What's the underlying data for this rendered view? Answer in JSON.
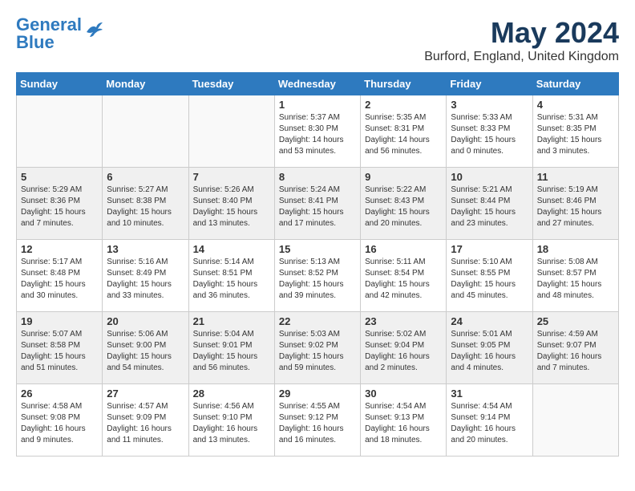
{
  "logo": {
    "line1": "General",
    "line2": "Blue"
  },
  "title": "May 2024",
  "location": "Burford, England, United Kingdom",
  "days_of_week": [
    "Sunday",
    "Monday",
    "Tuesday",
    "Wednesday",
    "Thursday",
    "Friday",
    "Saturday"
  ],
  "weeks": [
    [
      {
        "day": "",
        "text": ""
      },
      {
        "day": "",
        "text": ""
      },
      {
        "day": "",
        "text": ""
      },
      {
        "day": "1",
        "text": "Sunrise: 5:37 AM\nSunset: 8:30 PM\nDaylight: 14 hours and 53 minutes."
      },
      {
        "day": "2",
        "text": "Sunrise: 5:35 AM\nSunset: 8:31 PM\nDaylight: 14 hours and 56 minutes."
      },
      {
        "day": "3",
        "text": "Sunrise: 5:33 AM\nSunset: 8:33 PM\nDaylight: 15 hours and 0 minutes."
      },
      {
        "day": "4",
        "text": "Sunrise: 5:31 AM\nSunset: 8:35 PM\nDaylight: 15 hours and 3 minutes."
      }
    ],
    [
      {
        "day": "5",
        "text": "Sunrise: 5:29 AM\nSunset: 8:36 PM\nDaylight: 15 hours and 7 minutes."
      },
      {
        "day": "6",
        "text": "Sunrise: 5:27 AM\nSunset: 8:38 PM\nDaylight: 15 hours and 10 minutes."
      },
      {
        "day": "7",
        "text": "Sunrise: 5:26 AM\nSunset: 8:40 PM\nDaylight: 15 hours and 13 minutes."
      },
      {
        "day": "8",
        "text": "Sunrise: 5:24 AM\nSunset: 8:41 PM\nDaylight: 15 hours and 17 minutes."
      },
      {
        "day": "9",
        "text": "Sunrise: 5:22 AM\nSunset: 8:43 PM\nDaylight: 15 hours and 20 minutes."
      },
      {
        "day": "10",
        "text": "Sunrise: 5:21 AM\nSunset: 8:44 PM\nDaylight: 15 hours and 23 minutes."
      },
      {
        "day": "11",
        "text": "Sunrise: 5:19 AM\nSunset: 8:46 PM\nDaylight: 15 hours and 27 minutes."
      }
    ],
    [
      {
        "day": "12",
        "text": "Sunrise: 5:17 AM\nSunset: 8:48 PM\nDaylight: 15 hours and 30 minutes."
      },
      {
        "day": "13",
        "text": "Sunrise: 5:16 AM\nSunset: 8:49 PM\nDaylight: 15 hours and 33 minutes."
      },
      {
        "day": "14",
        "text": "Sunrise: 5:14 AM\nSunset: 8:51 PM\nDaylight: 15 hours and 36 minutes."
      },
      {
        "day": "15",
        "text": "Sunrise: 5:13 AM\nSunset: 8:52 PM\nDaylight: 15 hours and 39 minutes."
      },
      {
        "day": "16",
        "text": "Sunrise: 5:11 AM\nSunset: 8:54 PM\nDaylight: 15 hours and 42 minutes."
      },
      {
        "day": "17",
        "text": "Sunrise: 5:10 AM\nSunset: 8:55 PM\nDaylight: 15 hours and 45 minutes."
      },
      {
        "day": "18",
        "text": "Sunrise: 5:08 AM\nSunset: 8:57 PM\nDaylight: 15 hours and 48 minutes."
      }
    ],
    [
      {
        "day": "19",
        "text": "Sunrise: 5:07 AM\nSunset: 8:58 PM\nDaylight: 15 hours and 51 minutes."
      },
      {
        "day": "20",
        "text": "Sunrise: 5:06 AM\nSunset: 9:00 PM\nDaylight: 15 hours and 54 minutes."
      },
      {
        "day": "21",
        "text": "Sunrise: 5:04 AM\nSunset: 9:01 PM\nDaylight: 15 hours and 56 minutes."
      },
      {
        "day": "22",
        "text": "Sunrise: 5:03 AM\nSunset: 9:02 PM\nDaylight: 15 hours and 59 minutes."
      },
      {
        "day": "23",
        "text": "Sunrise: 5:02 AM\nSunset: 9:04 PM\nDaylight: 16 hours and 2 minutes."
      },
      {
        "day": "24",
        "text": "Sunrise: 5:01 AM\nSunset: 9:05 PM\nDaylight: 16 hours and 4 minutes."
      },
      {
        "day": "25",
        "text": "Sunrise: 4:59 AM\nSunset: 9:07 PM\nDaylight: 16 hours and 7 minutes."
      }
    ],
    [
      {
        "day": "26",
        "text": "Sunrise: 4:58 AM\nSunset: 9:08 PM\nDaylight: 16 hours and 9 minutes."
      },
      {
        "day": "27",
        "text": "Sunrise: 4:57 AM\nSunset: 9:09 PM\nDaylight: 16 hours and 11 minutes."
      },
      {
        "day": "28",
        "text": "Sunrise: 4:56 AM\nSunset: 9:10 PM\nDaylight: 16 hours and 13 minutes."
      },
      {
        "day": "29",
        "text": "Sunrise: 4:55 AM\nSunset: 9:12 PM\nDaylight: 16 hours and 16 minutes."
      },
      {
        "day": "30",
        "text": "Sunrise: 4:54 AM\nSunset: 9:13 PM\nDaylight: 16 hours and 18 minutes."
      },
      {
        "day": "31",
        "text": "Sunrise: 4:54 AM\nSunset: 9:14 PM\nDaylight: 16 hours and 20 minutes."
      },
      {
        "day": "",
        "text": ""
      }
    ]
  ]
}
